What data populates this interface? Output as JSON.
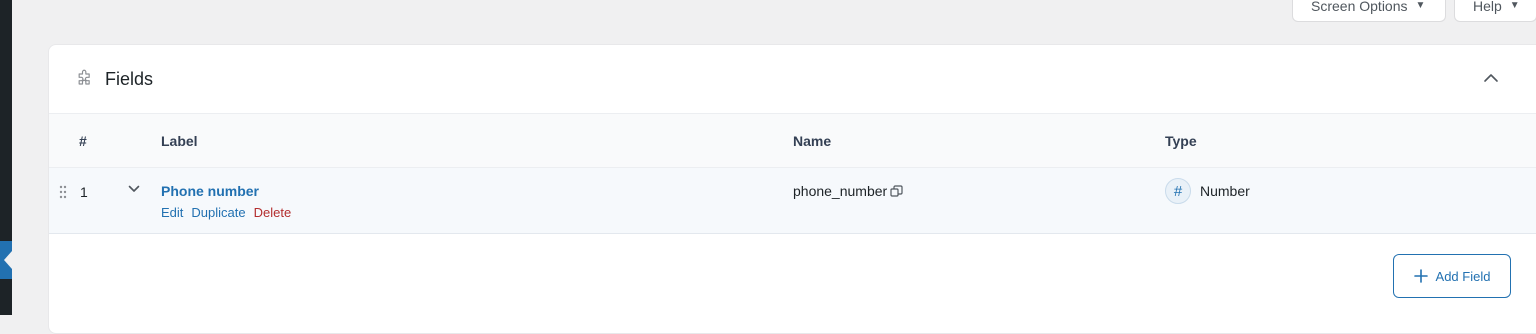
{
  "topbar": {
    "screen_options_label": "Screen Options",
    "help_label": "Help"
  },
  "panel": {
    "title": "Fields",
    "icon": "puzzle-icon",
    "collapse_icon": "chevron-up-icon"
  },
  "table": {
    "columns": {
      "order": "#",
      "label": "Label",
      "name": "Name",
      "type": "Type"
    },
    "rows": [
      {
        "order": "1",
        "label": "Phone number",
        "name": "phone_number",
        "type": "Number",
        "type_icon": "#",
        "actions": {
          "edit": "Edit",
          "duplicate": "Duplicate",
          "delete": "Delete"
        }
      }
    ]
  },
  "footer": {
    "add_field_label": "Add Field"
  },
  "colors": {
    "accent": "#2271b1",
    "danger": "#b32d2e",
    "admin_bar": "#1d2327"
  }
}
